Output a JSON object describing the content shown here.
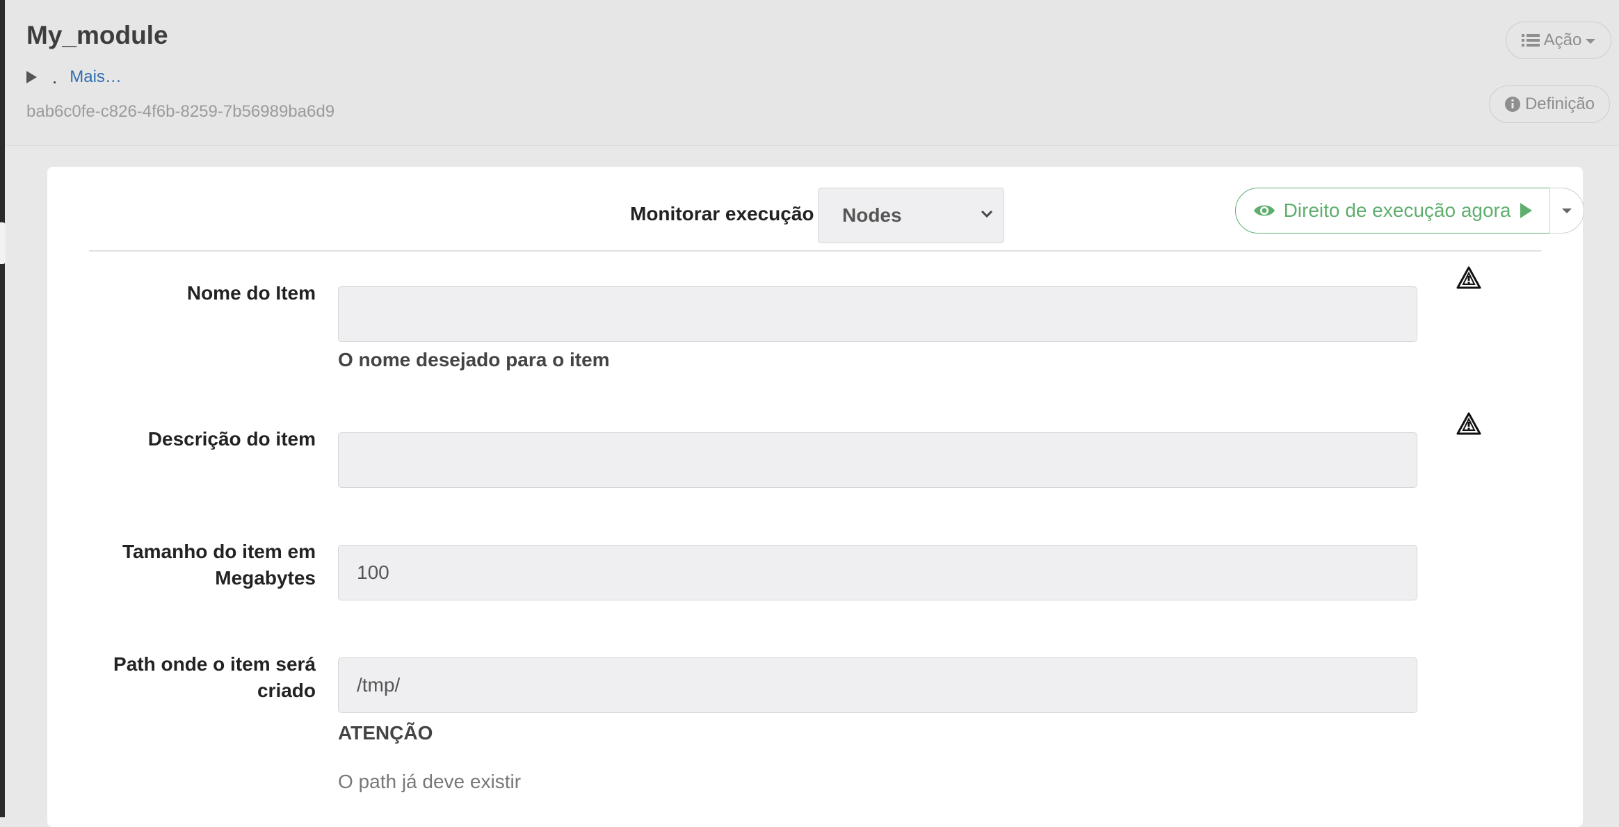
{
  "header": {
    "title": "My_module",
    "dot": ".",
    "more_link": "Mais…",
    "uuid": "bab6c0fe-c826-4f6b-8259-7b56989ba6d9",
    "action_button": "Ação",
    "definition_button": "Definição"
  },
  "run": {
    "monitor_label": "Monitorar execução",
    "monitor_selected": "Nodes",
    "execute_button": "Direito de execução agora"
  },
  "form": {
    "fields": [
      {
        "label": "Nome do Item",
        "value": "",
        "help": "O nome desejado para o item"
      },
      {
        "label": "Descrição do item",
        "value": ""
      },
      {
        "label_line1": "Tamanho do item em",
        "label_line2": "Megabytes",
        "value": "100"
      },
      {
        "label_line1": "Path onde o item será",
        "label_line2": "criado",
        "value": "/tmp/",
        "help_title": "ATENÇÃO",
        "help": "O path já deve existir"
      }
    ]
  }
}
